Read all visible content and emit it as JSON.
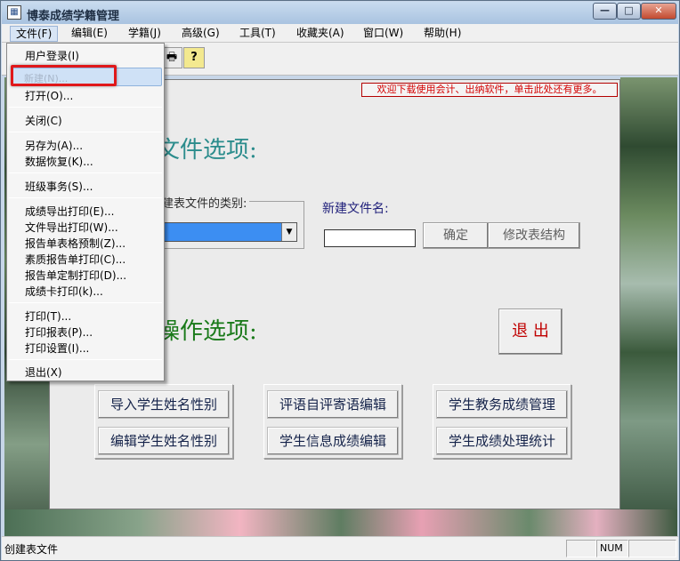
{
  "window": {
    "title": "博泰成绩学籍管理",
    "controls": {
      "minimize": "—",
      "maximize": "□",
      "close": "✕"
    }
  },
  "menubar": [
    "文件(F)",
    "编辑(E)",
    "学籍(J)",
    "高级(G)",
    "工具(T)",
    "收藏夹(A)",
    "窗口(W)",
    "帮助(H)"
  ],
  "toolbar": {
    "icons": [
      "print-preview-icon",
      "help-icon"
    ],
    "glyphs": [
      "🖶",
      "?"
    ]
  },
  "file_menu": {
    "items": [
      "用户登录(I)",
      "新建(N)...",
      "打开(O)...",
      "关闭(C)",
      "另存为(A)...",
      "数据恢复(K)...",
      "班级事务(S)...",
      "成绩导出打印(E)...",
      "文件导出打印(W)...",
      "报告单表格预制(Z)...",
      "素质报告单打印(C)...",
      "报告单定制打印(D)...",
      "成绩卡打印(k)...",
      "打印(T)...",
      "打印报表(P)...",
      "打印设置(I)...",
      "退出(X)"
    ],
    "highlighted": "新建(N)..."
  },
  "form": {
    "ad_banner": "欢迎下载使用会计、出纳软件，单击此处还有更多。",
    "section_file": "文件选项:",
    "type_label": "建表文件的类别:",
    "type_value": "",
    "newname_label": "新建文件名:",
    "newname_value": "",
    "ok_button": "确定",
    "modify_button": "修改表结构",
    "section_ops": "操作选项:",
    "exit_button": "退 出",
    "ops": [
      [
        "导入学生姓名性别",
        "编辑学生姓名性别"
      ],
      [
        "评语自评寄语编辑",
        "学生信息成绩编辑"
      ],
      [
        "学生教务成绩管理",
        "学生成绩处理统计"
      ]
    ]
  },
  "statusbar": {
    "text": "创建表文件",
    "num": "NUM"
  }
}
